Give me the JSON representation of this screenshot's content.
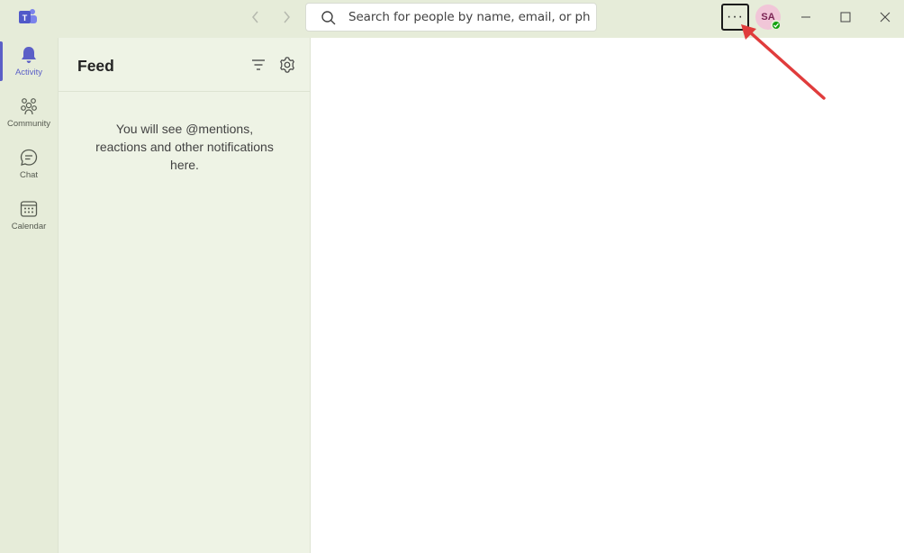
{
  "titlebar": {
    "app_icon": "teams-logo-icon",
    "back_icon": "chevron-left-icon",
    "forward_icon": "chevron-right-icon",
    "search": {
      "icon": "search-icon",
      "placeholder": "Search for people by name, email, or phone"
    },
    "more_button": "···",
    "avatar_initials": "SA",
    "presence": "available",
    "window_controls": [
      "minimize-icon",
      "maximize-icon",
      "close-icon"
    ]
  },
  "rail": {
    "items": [
      {
        "label": "Activity",
        "icon": "bell-icon",
        "active": true
      },
      {
        "label": "Community",
        "icon": "community-icon",
        "active": false
      },
      {
        "label": "Chat",
        "icon": "chat-icon",
        "active": false
      },
      {
        "label": "Calendar",
        "icon": "calendar-icon",
        "active": false
      }
    ]
  },
  "feed": {
    "title": "Feed",
    "filter_icon": "filter-icon",
    "settings_icon": "gear-icon",
    "empty_message": "You will see @mentions, reactions and other notifications here."
  },
  "colors": {
    "accent": "#5b5fc7",
    "chrome": "#e6ecd9",
    "feed_bg": "#eef3e5",
    "annotation": "#e03c3c",
    "presence": "#13a10e"
  }
}
